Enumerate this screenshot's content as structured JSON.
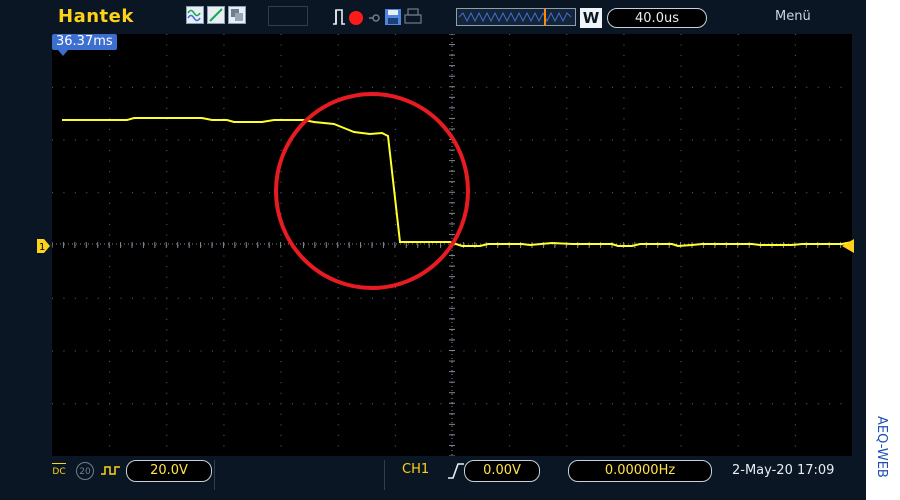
{
  "header": {
    "brand": "Hantek",
    "timebase": "40.0us",
    "menu_label": "Menü",
    "memory_mode": "W"
  },
  "overlay": {
    "time_position": "36.37ms"
  },
  "channel": {
    "marker": "1",
    "coupling": "DC",
    "bandwidth_limit": "20",
    "volts_per_div": "20.0V"
  },
  "trigger": {
    "source": "CH1",
    "level": "0.00V",
    "frequency": "0.00000Hz"
  },
  "status": {
    "datetime": "2-May-20 17:09"
  },
  "watermark": "AEQ-WEB",
  "colors": {
    "trace": "#ffff2a",
    "annotation": "#e81b23",
    "background": "#0a1624",
    "accent": "#3d6fd0"
  }
}
